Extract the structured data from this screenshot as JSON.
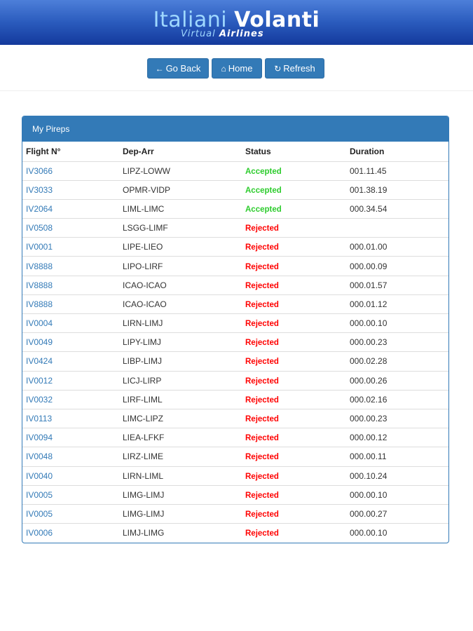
{
  "header": {
    "brand_word1": "Italiani",
    "brand_word2": "Volanti",
    "sub_word1": "Virtual",
    "sub_word2": "Airlines"
  },
  "toolbar": {
    "back_label": "Go Back",
    "home_label": "Home",
    "refresh_label": "Refresh"
  },
  "icons": {
    "back": "arrow-left-icon",
    "home": "home-icon",
    "refresh": "refresh-icon"
  },
  "colors": {
    "primary": "#337ab7",
    "accepted": "#2ecc2e",
    "rejected": "#ff0000"
  },
  "panel": {
    "title": "My Pireps",
    "columns": [
      "Flight N°",
      "Dep-Arr",
      "Status",
      "Duration"
    ]
  },
  "rows": [
    {
      "flight": "IV3066",
      "route": "LIPZ-LOWW",
      "status": "Accepted",
      "duration": "001.11.45"
    },
    {
      "flight": "IV3033",
      "route": "OPMR-VIDP",
      "status": "Accepted",
      "duration": "001.38.19"
    },
    {
      "flight": "IV2064",
      "route": "LIML-LIMC",
      "status": "Accepted",
      "duration": "000.34.54"
    },
    {
      "flight": "IV0508",
      "route": "LSGG-LIMF",
      "status": "Rejected",
      "duration": ""
    },
    {
      "flight": "IV0001",
      "route": "LIPE-LIEO",
      "status": "Rejected",
      "duration": "000.01.00"
    },
    {
      "flight": "IV8888",
      "route": "LIPO-LIRF",
      "status": "Rejected",
      "duration": "000.00.09"
    },
    {
      "flight": "IV8888",
      "route": "ICAO-ICAO",
      "status": "Rejected",
      "duration": "000.01.57"
    },
    {
      "flight": "IV8888",
      "route": "ICAO-ICAO",
      "status": "Rejected",
      "duration": "000.01.12"
    },
    {
      "flight": "IV0004",
      "route": "LIRN-LIMJ",
      "status": "Rejected",
      "duration": "000.00.10"
    },
    {
      "flight": "IV0049",
      "route": "LIPY-LIMJ",
      "status": "Rejected",
      "duration": "000.00.23"
    },
    {
      "flight": "IV0424",
      "route": "LIBP-LIMJ",
      "status": "Rejected",
      "duration": "000.02.28"
    },
    {
      "flight": "IV0012",
      "route": "LICJ-LIRP",
      "status": "Rejected",
      "duration": "000.00.26"
    },
    {
      "flight": "IV0032",
      "route": "LIRF-LIML",
      "status": "Rejected",
      "duration": "000.02.16"
    },
    {
      "flight": "IV0113",
      "route": "LIMC-LIPZ",
      "status": "Rejected",
      "duration": "000.00.23"
    },
    {
      "flight": "IV0094",
      "route": "LIEA-LFKF",
      "status": "Rejected",
      "duration": "000.00.12"
    },
    {
      "flight": "IV0048",
      "route": "LIRZ-LIME",
      "status": "Rejected",
      "duration": "000.00.11"
    },
    {
      "flight": "IV0040",
      "route": "LIRN-LIML",
      "status": "Rejected",
      "duration": "000.10.24"
    },
    {
      "flight": "IV0005",
      "route": "LIMG-LIMJ",
      "status": "Rejected",
      "duration": "000.00.10"
    },
    {
      "flight": "IV0005",
      "route": "LIMG-LIMJ",
      "status": "Rejected",
      "duration": "000.00.27"
    },
    {
      "flight": "IV0006",
      "route": "LIMJ-LIMG",
      "status": "Rejected",
      "duration": "000.00.10"
    }
  ]
}
